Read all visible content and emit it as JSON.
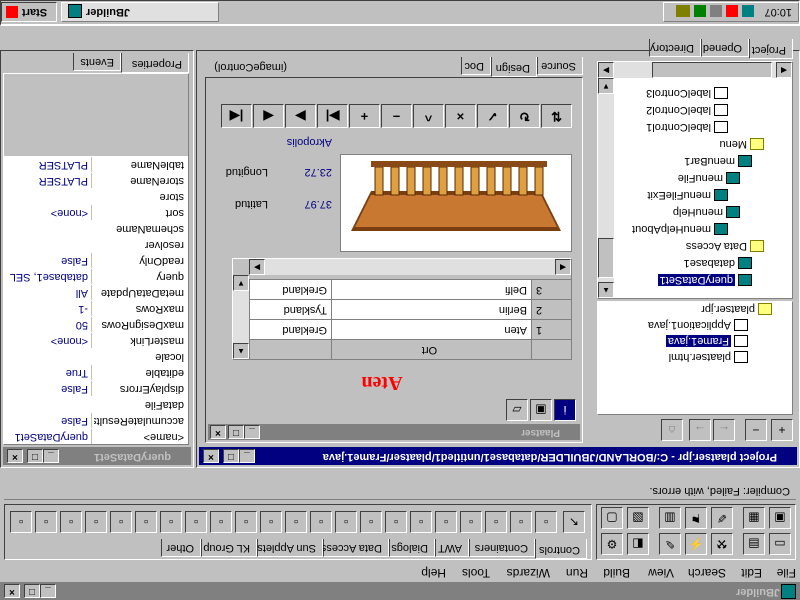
{
  "app": {
    "title": "JBuilder",
    "menu": [
      "File",
      "Edit",
      "Search",
      "View",
      "Build",
      "Run",
      "Wizards",
      "Tools",
      "Help"
    ],
    "compiler_status": "Compiler: Failed, with errors."
  },
  "palette": {
    "tabs": [
      "Controls",
      "Containers",
      "AWT",
      "Dialogs",
      "Data Access",
      "Sun Applets",
      "KL Group",
      "Other"
    ],
    "active_tab": "Controls"
  },
  "project": {
    "title": "Project plaatser.jpr - C:/BORLAND/JBUILDER/database1/untitled1/plaatser/Frame1.java",
    "tabs": [
      "Project",
      "Opened",
      "Directory"
    ],
    "files": [
      "plaatser.jpr",
      "Application1.java",
      "Frame1.java",
      "plaatser.html"
    ],
    "selected_file": "Frame1.java",
    "tree": [
      {
        "label": "labelControl3",
        "indent": 5,
        "icon": "doc"
      },
      {
        "label": "labelControl2",
        "indent": 5,
        "icon": "doc"
      },
      {
        "label": "labelControl1",
        "indent": 5,
        "icon": "doc"
      },
      {
        "label": "Menu",
        "indent": 2,
        "icon": "folder"
      },
      {
        "label": "menuBar1",
        "indent": 3,
        "icon": "db"
      },
      {
        "label": "menuFile",
        "indent": 4,
        "icon": "db"
      },
      {
        "label": "menuFileExit",
        "indent": 5,
        "icon": "db"
      },
      {
        "label": "menuHelp",
        "indent": 4,
        "icon": "db"
      },
      {
        "label": "menuHelpAbout",
        "indent": 5,
        "icon": "db"
      },
      {
        "label": "Data Access",
        "indent": 2,
        "icon": "folder"
      },
      {
        "label": "database1",
        "indent": 3,
        "icon": "db"
      },
      {
        "label": "queryDataSet1",
        "indent": 3,
        "icon": "db",
        "selected": true
      }
    ]
  },
  "editor": {
    "tabs": [
      "Source",
      "Design",
      "Doc"
    ],
    "active_tab": "Design",
    "component_label": "(imageControl)"
  },
  "designer": {
    "frame_title": "Plaatser",
    "heading": "Aten",
    "image_caption": "Akropolis",
    "longitud_label": "Longitud",
    "longitud_value": "23.72",
    "latitud_label": "Latitud",
    "latitud_value": "37.97",
    "grid_header": "Ort",
    "grid_rows": [
      {
        "num": "1",
        "city": "Aten",
        "country": "Grekland"
      },
      {
        "num": "2",
        "city": "Berlin",
        "country": "Tyskland"
      },
      {
        "num": "3",
        "city": "Delfi",
        "country": "Grekland"
      }
    ],
    "navigator": [
      "first",
      "prior",
      "next",
      "last",
      "insert",
      "delete",
      "edit",
      "cancel",
      "post",
      "refresh",
      "ditto"
    ]
  },
  "inspector": {
    "title": "queryDataSet1",
    "tabs": [
      "Properties",
      "Events"
    ],
    "properties": [
      {
        "name": "<name>",
        "value": "queryDataSet1"
      },
      {
        "name": "accumulateResults",
        "value": "False"
      },
      {
        "name": "dataFile",
        "value": ""
      },
      {
        "name": "displayErrors",
        "value": "False"
      },
      {
        "name": "editable",
        "value": "True"
      },
      {
        "name": "locale",
        "value": ""
      },
      {
        "name": "masterLink",
        "value": "<none>"
      },
      {
        "name": "maxDesignRows",
        "value": "50"
      },
      {
        "name": "maxRows",
        "value": "-1"
      },
      {
        "name": "metaDataUpdate",
        "value": "All"
      },
      {
        "name": "query",
        "value": "database1, SEL"
      },
      {
        "name": "readOnly",
        "value": "False"
      },
      {
        "name": "resolver",
        "value": ""
      },
      {
        "name": "schemaName",
        "value": ""
      },
      {
        "name": "sort",
        "value": "<none>"
      },
      {
        "name": "store",
        "value": ""
      },
      {
        "name": "storeName",
        "value": "PLATSER"
      },
      {
        "name": "tableName",
        "value": "PLATSER"
      }
    ]
  },
  "taskbar": {
    "start_label": "Start",
    "task_label": "JBuilder",
    "clock": "10:07"
  },
  "colors": {
    "titlebar_active": "#000080",
    "desktop_gray": "#c0c0c0",
    "heading_red": "#ff0000",
    "value_blue": "#000080"
  }
}
